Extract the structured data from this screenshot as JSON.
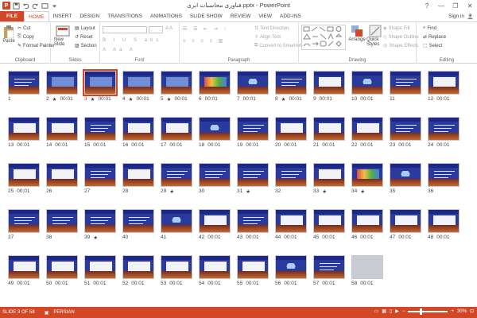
{
  "window": {
    "title": "فناوری محاسبات ابری.pptx - PowerPoint",
    "controls": [
      "?",
      "—",
      "❐",
      "✕"
    ]
  },
  "tabs": [
    "FILE",
    "HOME",
    "INSERT",
    "DESIGN",
    "TRANSITIONS",
    "ANIMATIONS",
    "SLIDE SHOW",
    "REVIEW",
    "VIEW",
    "ADD-INS"
  ],
  "active_tab": "HOME",
  "signin": "Sign in",
  "ribbon": {
    "clipboard": {
      "label": "Clipboard",
      "paste": "Paste",
      "cut": "Cut",
      "copy": "Copy",
      "format_painter": "Format Painter"
    },
    "slides": {
      "label": "Slides",
      "new_slide": "New Slide",
      "layout": "Layout",
      "reset": "Reset",
      "section": "Section"
    },
    "font": {
      "label": "Font"
    },
    "paragraph": {
      "label": "Paragraph",
      "text_direction": "Text Direction",
      "align_text": "Align Text",
      "convert": "Convert to SmartArt"
    },
    "drawing": {
      "label": "Drawing",
      "arrange": "Arrange",
      "quick_styles": "Quick Styles",
      "shape_fill": "Shape Fill",
      "shape_outline": "Shape Outline",
      "shape_effects": "Shape Effects"
    },
    "editing": {
      "label": "Editing",
      "find": "Find",
      "replace": "Replace",
      "select": "Select"
    }
  },
  "slides": [
    {
      "num": "1",
      "time": "",
      "star": false,
      "kind": "title"
    },
    {
      "num": "2",
      "time": "00:01",
      "star": true,
      "kind": "diagram"
    },
    {
      "num": "3",
      "time": "00:01",
      "star": true,
      "kind": "diagram",
      "selected": true
    },
    {
      "num": "4",
      "time": "00:01",
      "star": true,
      "kind": "diagram"
    },
    {
      "num": "5",
      "time": "00:01",
      "star": true,
      "kind": "diagram"
    },
    {
      "num": "6",
      "time": "00:01",
      "star": false,
      "kind": "colorful"
    },
    {
      "num": "7",
      "time": "00:01",
      "star": false,
      "kind": "cloud"
    },
    {
      "num": "8",
      "time": "00:01",
      "star": true,
      "kind": "text"
    },
    {
      "num": "9",
      "time": "00:01",
      "star": false,
      "kind": "content"
    },
    {
      "num": "10",
      "time": "00:01",
      "star": false,
      "kind": "cloud"
    },
    {
      "num": "11",
      "time": "",
      "star": false,
      "kind": "text"
    },
    {
      "num": "12",
      "time": "00:01",
      "star": false,
      "kind": "content"
    },
    {
      "num": "13",
      "time": "00:01",
      "star": false,
      "kind": "content"
    },
    {
      "num": "14",
      "time": "00:01",
      "star": false,
      "kind": "content"
    },
    {
      "num": "15",
      "time": "00:01",
      "star": false,
      "kind": "text"
    },
    {
      "num": "16",
      "time": "00:01",
      "star": false,
      "kind": "content"
    },
    {
      "num": "17",
      "time": "00:01",
      "star": false,
      "kind": "content"
    },
    {
      "num": "18",
      "time": "00:01",
      "star": false,
      "kind": "cloud"
    },
    {
      "num": "19",
      "time": "00:01",
      "star": false,
      "kind": "text"
    },
    {
      "num": "20",
      "time": "00:01",
      "star": false,
      "kind": "content"
    },
    {
      "num": "21",
      "time": "00:01",
      "star": false,
      "kind": "content"
    },
    {
      "num": "22",
      "time": "00:01",
      "star": false,
      "kind": "content"
    },
    {
      "num": "23",
      "time": "00:01",
      "star": false,
      "kind": "text"
    },
    {
      "num": "24",
      "time": "00:01",
      "star": false,
      "kind": "text"
    },
    {
      "num": "25",
      "time": "00:01",
      "star": false,
      "kind": "content"
    },
    {
      "num": "26",
      "time": "",
      "star": false,
      "kind": "content"
    },
    {
      "num": "27",
      "time": "",
      "star": false,
      "kind": "text"
    },
    {
      "num": "28",
      "time": "",
      "star": false,
      "kind": "content"
    },
    {
      "num": "29",
      "time": "",
      "star": true,
      "kind": "text"
    },
    {
      "num": "30",
      "time": "",
      "star": false,
      "kind": "text"
    },
    {
      "num": "31",
      "time": "",
      "star": true,
      "kind": "text"
    },
    {
      "num": "32",
      "time": "",
      "star": false,
      "kind": "text"
    },
    {
      "num": "33",
      "time": "",
      "star": true,
      "kind": "content"
    },
    {
      "num": "34",
      "time": "",
      "star": true,
      "kind": "colorful"
    },
    {
      "num": "35",
      "time": "",
      "star": false,
      "kind": "cloud"
    },
    {
      "num": "36",
      "time": "",
      "star": false,
      "kind": "text"
    },
    {
      "num": "37",
      "time": "",
      "star": false,
      "kind": "text"
    },
    {
      "num": "38",
      "time": "",
      "star": false,
      "kind": "text"
    },
    {
      "num": "39",
      "time": "",
      "star": true,
      "kind": "text"
    },
    {
      "num": "40",
      "time": "",
      "star": false,
      "kind": "text"
    },
    {
      "num": "41",
      "time": "",
      "star": false,
      "kind": "cloud"
    },
    {
      "num": "42",
      "time": "00:01",
      "star": false,
      "kind": "content"
    },
    {
      "num": "43",
      "time": "00:01",
      "star": false,
      "kind": "text"
    },
    {
      "num": "44",
      "time": "00:01",
      "star": false,
      "kind": "content"
    },
    {
      "num": "45",
      "time": "00:01",
      "star": false,
      "kind": "content"
    },
    {
      "num": "46",
      "time": "00:01",
      "star": false,
      "kind": "content"
    },
    {
      "num": "47",
      "time": "00:01",
      "star": false,
      "kind": "content"
    },
    {
      "num": "48",
      "time": "00:01",
      "star": false,
      "kind": "content"
    },
    {
      "num": "49",
      "time": "00:01",
      "star": false,
      "kind": "content"
    },
    {
      "num": "50",
      "time": "00:01",
      "star": false,
      "kind": "content"
    },
    {
      "num": "51",
      "time": "00:01",
      "star": false,
      "kind": "content"
    },
    {
      "num": "52",
      "time": "00:01",
      "star": false,
      "kind": "content"
    },
    {
      "num": "53",
      "time": "00:01",
      "star": false,
      "kind": "content"
    },
    {
      "num": "54",
      "time": "00:01",
      "star": false,
      "kind": "content"
    },
    {
      "num": "55",
      "time": "00:01",
      "star": false,
      "kind": "content"
    },
    {
      "num": "56",
      "time": "00:01",
      "star": false,
      "kind": "cloud"
    },
    {
      "num": "57",
      "time": "00:01",
      "star": false,
      "kind": "text"
    },
    {
      "num": "58",
      "time": "00:01",
      "star": false,
      "kind": "photo"
    }
  ],
  "status": {
    "slide": "SLIDE 3 OF 58",
    "language": "PERSIAN",
    "zoom": "30%",
    "zoom_level": 0.3
  },
  "colors": {
    "accent": "#d24726",
    "slide_bg": "#2a3a9c"
  }
}
